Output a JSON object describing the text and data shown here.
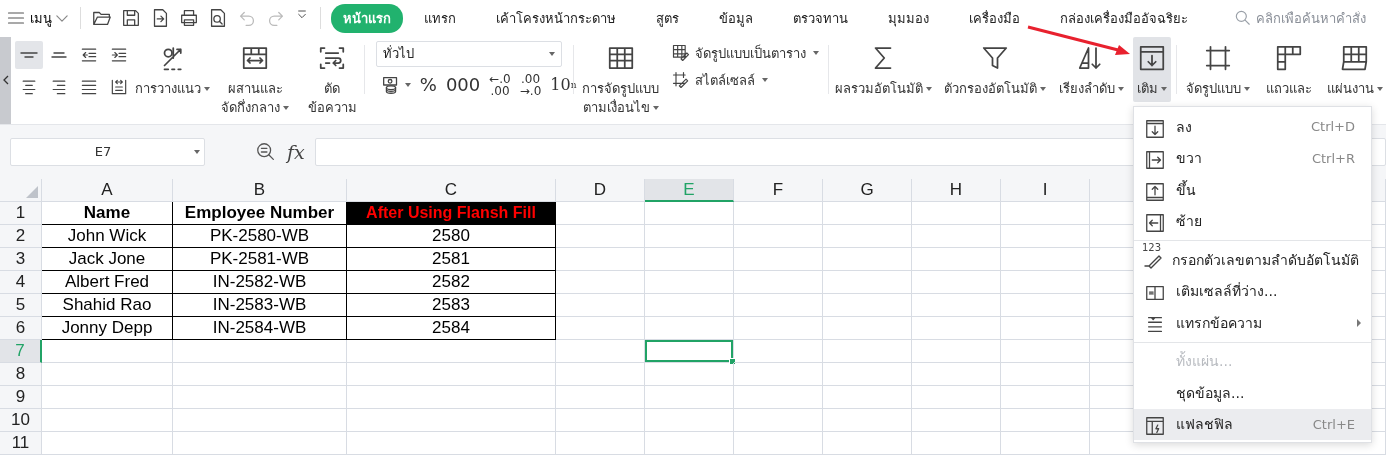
{
  "menu_bar": {
    "menu_label": "เมนู",
    "quick_access": [
      {
        "kind": "open",
        "disabled": false
      },
      {
        "kind": "save",
        "disabled": false
      },
      {
        "kind": "export",
        "disabled": false
      },
      {
        "kind": "print",
        "disabled": false
      },
      {
        "kind": "preview",
        "disabled": false
      },
      {
        "kind": "undo",
        "disabled": true
      },
      {
        "kind": "redo",
        "disabled": true
      },
      {
        "kind": "customize",
        "disabled": false
      }
    ],
    "tabs": [
      {
        "label": "หน้าแรก",
        "selected": true
      },
      {
        "label": "แทรก",
        "selected": false
      },
      {
        "label": "เค้าโครงหน้ากระดาษ",
        "selected": false
      },
      {
        "label": "สูตร",
        "selected": false
      },
      {
        "label": "ข้อมูล",
        "selected": false
      },
      {
        "label": "ตรวจทาน",
        "selected": false
      },
      {
        "label": "มุมมอง",
        "selected": false
      },
      {
        "label": "เครื่องมือ",
        "selected": false
      },
      {
        "label": "กล่องเครื่องมืออัจฉริยะ",
        "selected": false
      }
    ],
    "search": {
      "placeholder": "คลิกเพื่อค้นหาคำสั่ง"
    }
  },
  "ribbon": {
    "alignment_buttons": [
      {
        "kind": "top",
        "selected": true
      },
      {
        "kind": "middle",
        "selected": false
      },
      {
        "kind": "outdent",
        "selected": false
      },
      {
        "kind": "indent",
        "selected": false
      },
      {
        "kind": "center",
        "selected": false
      },
      {
        "kind": "right",
        "selected": false
      },
      {
        "kind": "justify",
        "selected": false
      },
      {
        "kind": "distributed",
        "selected": false
      }
    ],
    "alignment_tools": [
      {
        "kind": "orientation",
        "lines": [
          "การวางแนว"
        ],
        "dropdown": true,
        "selected": false
      },
      {
        "kind": "merge",
        "lines": [
          "ผสานและ",
          "จัดกึ่งกลาง"
        ],
        "dropdown": true,
        "selected": false
      },
      {
        "kind": "wrap",
        "lines": [
          "ตัด",
          "ข้อความ"
        ],
        "dropdown": false,
        "selected": false
      }
    ],
    "number_format": {
      "value": "ทั่วไป",
      "buttons": [
        {
          "kind": "currency",
          "dropdown": true
        },
        {
          "kind": "text",
          "lines": [
            "%"
          ]
        },
        {
          "kind": "text",
          "lines": [
            "000"
          ]
        },
        {
          "kind": "text",
          "lines": [
            "←.0",
            ".00"
          ]
        },
        {
          "kind": "text",
          "lines": [
            ".00",
            "→.0"
          ]
        },
        {
          "kind": "text",
          "lines": [
            "10$^{n}$"
          ]
        }
      ]
    },
    "style_tools": {
      "conditional": {
        "kind": "conditional",
        "lines": [
          "การจัดรูปแบบ",
          "ตามเงื่อนไข"
        ],
        "dropdown": true,
        "selected": false
      },
      "small": [
        {
          "kind": "table_format",
          "label": "จัดรูปแบบเป็นตาราง",
          "dropdown": true
        },
        {
          "kind": "cell_style",
          "label": "สไตล์เซลล์",
          "dropdown": true
        }
      ]
    },
    "edit_tools": [
      {
        "kind": "sum",
        "lines": [
          "ผลรวมอัตโนมัติ"
        ],
        "dropdown": true,
        "selected": false
      },
      {
        "kind": "filter",
        "lines": [
          "ตัวกรองอัตโนมัติ"
        ],
        "dropdown": true,
        "selected": false
      },
      {
        "kind": "sort",
        "lines": [
          "เรียงลำดับ"
        ],
        "dropdown": true,
        "selected": false
      },
      {
        "kind": "fill",
        "lines": [
          "เติม"
        ],
        "dropdown": true,
        "selected": true
      }
    ],
    "format_tools": [
      {
        "kind": "format",
        "lines": [
          "จัดรูปแบบ"
        ],
        "dropdown": true,
        "selected": false
      },
      {
        "kind": "rows",
        "lines": [
          "แถวและ"
        ],
        "dropdown": false,
        "selected": false
      },
      {
        "kind": "sheet",
        "lines": [
          "แผ่นงาน"
        ],
        "dropdown": true,
        "selected": false
      }
    ]
  },
  "formula_bar": {
    "name_box": "E7",
    "fx_label": "fx"
  },
  "sheet": {
    "columns": [
      {
        "label": "A",
        "selected": false
      },
      {
        "label": "B",
        "selected": false
      },
      {
        "label": "C",
        "selected": false
      },
      {
        "label": "D",
        "selected": false
      },
      {
        "label": "E",
        "selected": true
      },
      {
        "label": "F",
        "selected": false
      },
      {
        "label": "G",
        "selected": false
      },
      {
        "label": "H",
        "selected": false
      },
      {
        "label": "I",
        "selected": false
      }
    ],
    "rows": [
      {
        "label": "1",
        "selected": false,
        "cells": [
          {
            "text": "Name",
            "kind": "header"
          },
          {
            "text": "Employee Number",
            "kind": "header"
          },
          {
            "text": "After Using Flansh Fill",
            "kind": "banner"
          }
        ]
      },
      {
        "label": "2",
        "selected": false,
        "cells": [
          {
            "text": "John Wick",
            "kind": "data"
          },
          {
            "text": "PK-2580-WB",
            "kind": "data"
          },
          {
            "text": "2580",
            "kind": "data"
          }
        ]
      },
      {
        "label": "3",
        "selected": false,
        "cells": [
          {
            "text": "Jack Jone",
            "kind": "data"
          },
          {
            "text": "PK-2581-WB",
            "kind": "data"
          },
          {
            "text": "2581",
            "kind": "data"
          }
        ]
      },
      {
        "label": "4",
        "selected": false,
        "cells": [
          {
            "text": "Albert Fred",
            "kind": "data"
          },
          {
            "text": "IN-2582-WB",
            "kind": "data"
          },
          {
            "text": "2582",
            "kind": "data"
          }
        ]
      },
      {
        "label": "5",
        "selected": false,
        "cells": [
          {
            "text": "Shahid Rao",
            "kind": "data"
          },
          {
            "text": "IN-2583-WB",
            "kind": "data"
          },
          {
            "text": "2583",
            "kind": "data"
          }
        ]
      },
      {
        "label": "6",
        "selected": false,
        "cells": [
          {
            "text": "Jonny Depp",
            "kind": "data"
          },
          {
            "text": "IN-2584-WB",
            "kind": "data"
          },
          {
            "text": "2584",
            "kind": "data"
          }
        ]
      },
      {
        "label": "7",
        "selected": true,
        "cells": []
      },
      {
        "label": "8",
        "selected": false,
        "cells": []
      },
      {
        "label": "9",
        "selected": false,
        "cells": []
      },
      {
        "label": "10",
        "selected": false,
        "cells": []
      },
      {
        "label": "11",
        "selected": false,
        "cells": []
      }
    ]
  },
  "fill_menu": {
    "groups": [
      [
        {
          "kind": "down",
          "label": "ลง",
          "shortcut": "Ctrl+D",
          "disabled": false,
          "selected": false,
          "submenu": false
        },
        {
          "kind": "right",
          "label": "ขวา",
          "shortcut": "Ctrl+R",
          "disabled": false,
          "selected": false,
          "submenu": false
        },
        {
          "kind": "up",
          "label": "ขึ้น",
          "disabled": false,
          "selected": false,
          "submenu": false
        },
        {
          "kind": "left",
          "label": "ซ้าย",
          "disabled": false,
          "selected": false,
          "submenu": false
        }
      ],
      [
        {
          "kind": "series",
          "icon_text": "123",
          "label": "กรอกตัวเลขตามลำดับอัตโนมัติ",
          "disabled": false,
          "selected": false,
          "submenu": false
        },
        {
          "kind": "blank",
          "label": "เติมเซลล์ที่ว่าง...",
          "disabled": false,
          "selected": false,
          "submenu": false
        },
        {
          "kind": "text",
          "label": "แทรกข้อความ",
          "disabled": false,
          "selected": false,
          "submenu": true
        }
      ],
      [
        {
          "kind": "none",
          "label": "ทั้งแผ่น...",
          "disabled": true,
          "selected": false,
          "submenu": false
        },
        {
          "kind": "none",
          "label": "ชุดข้อมูล...",
          "disabled": false,
          "selected": false,
          "submenu": false
        },
        {
          "kind": "flash",
          "label": "แฟลชฟิล",
          "shortcut": "Ctrl+E",
          "disabled": false,
          "selected": true,
          "submenu": false
        }
      ]
    ]
  }
}
